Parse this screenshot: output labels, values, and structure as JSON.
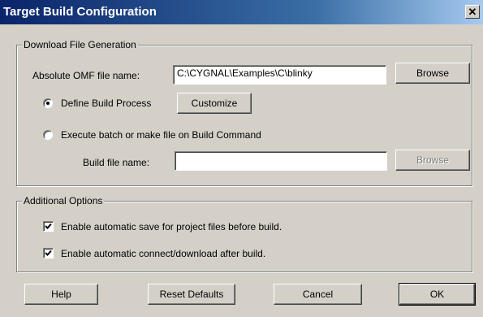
{
  "window": {
    "title": "Target Build Configuration",
    "close_glyph": "✕",
    "close_icon": "close-icon"
  },
  "download_group": {
    "legend": "Download File Generation",
    "omf_label": "Absolute OMF file name:",
    "omf_value": "C:\\CYGNAL\\Examples\\C\\blinky",
    "browse_label": "Browse",
    "define_build_label": "Define Build Process",
    "define_build_selected": true,
    "customize_label": "Customize",
    "execute_batch_label": "Execute batch or make file on Build Command",
    "execute_batch_selected": false,
    "build_file_label": "Build file name:",
    "build_file_value": "",
    "build_browse_label": "Browse"
  },
  "options_group": {
    "legend": "Additional Options",
    "autosave_label": "Enable automatic save for project files before build.",
    "autosave_checked": true,
    "autoconnect_label": "Enable automatic connect/download after build.",
    "autoconnect_checked": true
  },
  "buttons": {
    "help": "Help",
    "reset": "Reset Defaults",
    "cancel": "Cancel",
    "ok": "OK"
  }
}
